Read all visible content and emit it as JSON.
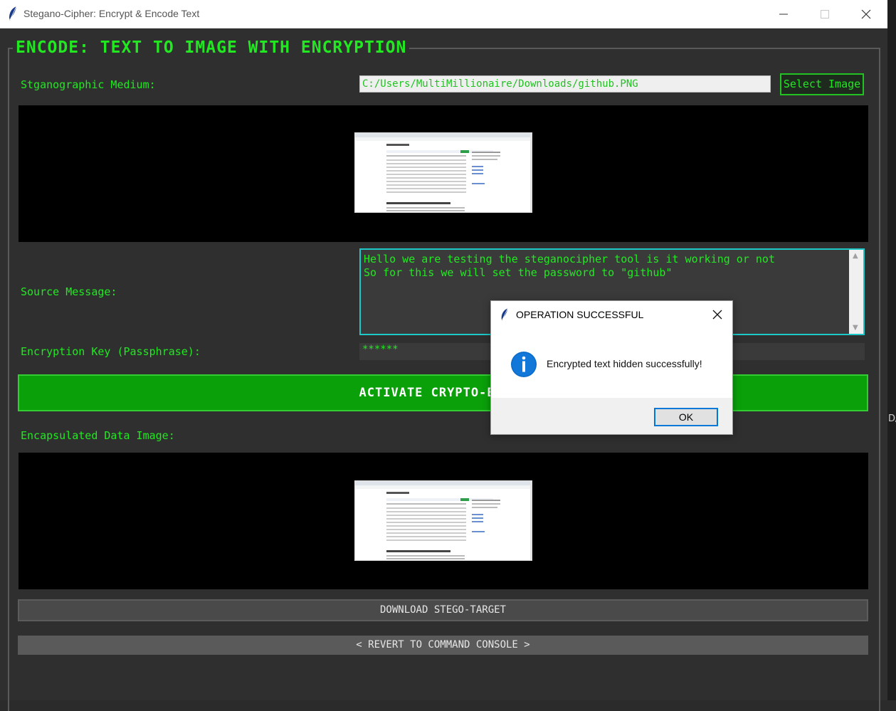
{
  "window": {
    "title": "Stegano-Cipher: Encrypt & Encode Text"
  },
  "section": {
    "title": "ENCODE: TEXT TO IMAGE WITH ENCRYPTION"
  },
  "medium": {
    "label": "Stganographic Medium:",
    "path": "C:/Users/MultiMillionaire/Downloads/github.PNG",
    "select_button": "Select Image"
  },
  "source": {
    "label": "Source Message:",
    "text": "Hello we are testing the steganocipher tool is it working or not\nSo for this we will set the password to \"github\""
  },
  "key": {
    "label": "Encryption Key (Passphrase):",
    "value": "******"
  },
  "actions": {
    "activate": "ACTIVATE CRYPTO-EMBED",
    "output_label": "Encapsulated Data Image:",
    "download": "DOWNLOAD STEGO-TARGET",
    "revert": "< REVERT TO COMMAND CONSOLE >"
  },
  "dialog": {
    "title": "OPERATION SUCCESSFUL",
    "message": "Encrypted text hidden successfully!",
    "ok": "OK"
  },
  "background_fragment": "D/",
  "colors": {
    "accent_green": "#22e822",
    "button_green": "#0aa00a",
    "cyan_border": "#1ec8c8",
    "dialog_blue": "#0078d7"
  }
}
